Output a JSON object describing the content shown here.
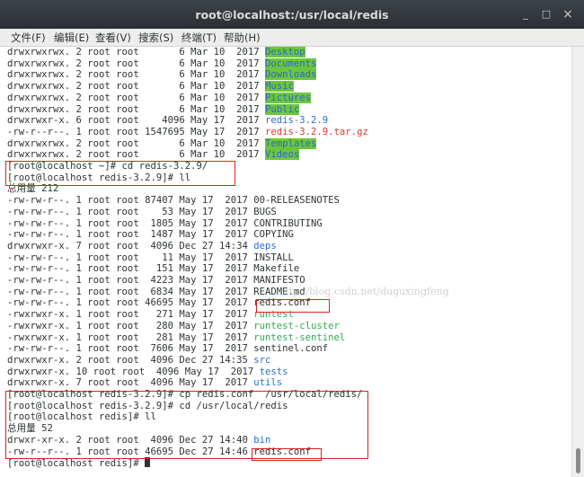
{
  "window": {
    "title": "root@localhost:/usr/local/redis",
    "minimize_glyph": "_",
    "maximize_glyph": "□",
    "close_glyph": "×"
  },
  "menu": [
    "文件(F)",
    "编辑(E)",
    "查看(V)",
    "搜索(S)",
    "终端(T)",
    "帮助(H)"
  ],
  "watermark": "http://blog.csdn.net/duguxingfeng",
  "colors": {
    "dir_blue": "#2a6fd0",
    "exec_green": "#34a853",
    "archive_red": "#d43a30",
    "sticky_bg": "#6cc63c",
    "highlight_box": "#e02020"
  },
  "terminal": {
    "lines": [
      {
        "prefix": "drwxrwxrwx. 2 root root       6 Mar 10  2017 ",
        "name": "Desktop",
        "style": "sticky"
      },
      {
        "prefix": "drwxrwxrwx. 2 root root       6 Mar 10  2017 ",
        "name": "Documents",
        "style": "sticky"
      },
      {
        "prefix": "drwxrwxrwx. 2 root root       6 Mar 10  2017 ",
        "name": "Downloads",
        "style": "sticky"
      },
      {
        "prefix": "drwxrwxrwx. 2 root root       6 Mar 10  2017 ",
        "name": "Music",
        "style": "sticky"
      },
      {
        "prefix": "drwxrwxrwx. 2 root root       6 Mar 10  2017 ",
        "name": "Pictures",
        "style": "sticky"
      },
      {
        "prefix": "drwxrwxrwx. 2 root root       6 Mar 10  2017 ",
        "name": "Public",
        "style": "sticky"
      },
      {
        "prefix": "drwxrwxr-x. 6 root root    4096 May 17  2017 ",
        "name": "redis-3.2.9",
        "style": "dir"
      },
      {
        "prefix": "-rw-r--r--. 1 root root 1547695 May 17  2017 ",
        "name": "redis-3.2.9.tar.gz",
        "style": "archive"
      },
      {
        "prefix": "drwxrwxrwx. 2 root root       6 Mar 10  2017 ",
        "name": "Templates",
        "style": "sticky"
      },
      {
        "prefix": "drwxrwxrwx. 2 root root       6 Mar 10  2017 ",
        "name": "Videos",
        "style": "sticky"
      },
      {
        "prefix": "[root@localhost ~]# cd redis-3.2.9/",
        "name": "",
        "style": "plain"
      },
      {
        "prefix": "[root@localhost redis-3.2.9]# ll",
        "name": "",
        "style": "plain"
      },
      {
        "prefix": "总用量 212",
        "name": "",
        "style": "plain"
      },
      {
        "prefix": "-rw-rw-r--. 1 root root 87407 May 17  2017 00-RELEASENOTES",
        "name": "",
        "style": "plain"
      },
      {
        "prefix": "-rw-rw-r--. 1 root root    53 May 17  2017 BUGS",
        "name": "",
        "style": "plain"
      },
      {
        "prefix": "-rw-rw-r--. 1 root root  1805 May 17  2017 CONTRIBUTING",
        "name": "",
        "style": "plain"
      },
      {
        "prefix": "-rw-rw-r--. 1 root root  1487 May 17  2017 COPYING",
        "name": "",
        "style": "plain"
      },
      {
        "prefix": "drwxrwxr-x. 7 root root  4096 Dec 27 14:34 ",
        "name": "deps",
        "style": "dir"
      },
      {
        "prefix": "-rw-rw-r--. 1 root root    11 May 17  2017 INSTALL",
        "name": "",
        "style": "plain"
      },
      {
        "prefix": "-rw-rw-r--. 1 root root   151 May 17  2017 Makefile",
        "name": "",
        "style": "plain"
      },
      {
        "prefix": "-rw-rw-r--. 1 root root  4223 May 17  2017 MANIFESTO",
        "name": "",
        "style": "plain"
      },
      {
        "prefix": "-rw-rw-r--. 1 root root  6834 May 17  2017 README.md",
        "name": "",
        "style": "plain"
      },
      {
        "prefix": "-rw-rw-r--. 1 root root 46695 May 17  2017 redis.conf",
        "name": "",
        "style": "plain"
      },
      {
        "prefix": "-rwxrwxr-x. 1 root root   271 May 17  2017 ",
        "name": "runtest",
        "style": "exec"
      },
      {
        "prefix": "-rwxrwxr-x. 1 root root   280 May 17  2017 ",
        "name": "runtest-cluster",
        "style": "exec"
      },
      {
        "prefix": "-rwxrwxr-x. 1 root root   281 May 17  2017 ",
        "name": "runtest-sentinel",
        "style": "exec"
      },
      {
        "prefix": "-rw-rw-r--. 1 root root  7606 May 17  2017 sentinel.conf",
        "name": "",
        "style": "plain"
      },
      {
        "prefix": "drwxrwxr-x. 2 root root  4096 Dec 27 14:35 ",
        "name": "src",
        "style": "dir"
      },
      {
        "prefix": "drwxrwxr-x. 10 root root  4096 May 17  2017 ",
        "name": "tests",
        "style": "dir"
      },
      {
        "prefix": "drwxrwxr-x. 7 root root  4096 May 17  2017 ",
        "name": "utils",
        "style": "dir"
      },
      {
        "prefix": "[root@localhost redis-3.2.9]# cp redis.conf  /usr/local/redis/",
        "name": "",
        "style": "plain"
      },
      {
        "prefix": "[root@localhost redis-3.2.9]# cd /usr/local/redis",
        "name": "",
        "style": "plain"
      },
      {
        "prefix": "[root@localhost redis]# ll",
        "name": "",
        "style": "plain"
      },
      {
        "prefix": "总用量 52",
        "name": "",
        "style": "plain"
      },
      {
        "prefix": "drwxr-xr-x. 2 root root  4096 Dec 27 14:40 ",
        "name": "bin",
        "style": "dir"
      },
      {
        "prefix": "-rw-r--r--. 1 root root 46695 Dec 27 14:46 redis.conf",
        "name": "",
        "style": "plain"
      },
      {
        "prefix": "[root@localhost redis]# ",
        "name": "",
        "style": "prompt"
      }
    ]
  }
}
